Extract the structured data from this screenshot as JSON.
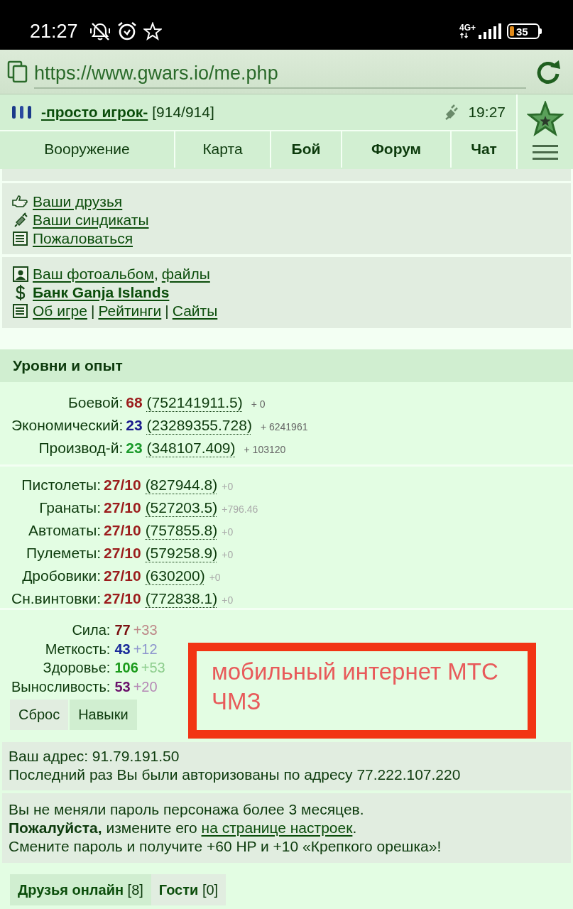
{
  "status_bar": {
    "time": "21:27",
    "network": "4G+",
    "battery": "35"
  },
  "address_bar": {
    "url": "https://www.gwars.io/me.php"
  },
  "header": {
    "player": "-просто игрок-",
    "health": "[914/914]",
    "server_time": "19:27",
    "tabs": [
      {
        "label": "Вооружение",
        "bold": false
      },
      {
        "label": "Карта",
        "bold": false
      },
      {
        "label": "Бой",
        "bold": true
      },
      {
        "label": "Форум",
        "bold": true
      },
      {
        "label": "Чат",
        "bold": true
      }
    ]
  },
  "menu_panels": [
    {
      "items": [
        {
          "bold": false,
          "parts": [
            {
              "kind": "link",
              "text": "Ваши друзья"
            }
          ]
        },
        {
          "bold": false,
          "parts": [
            {
              "kind": "link",
              "text": "Ваши синдикаты"
            }
          ]
        },
        {
          "bold": false,
          "parts": [
            {
              "kind": "link",
              "text": "Пожаловаться"
            }
          ]
        }
      ]
    },
    {
      "items": [
        {
          "bold": false,
          "parts": [
            {
              "kind": "link",
              "text": "Ваш фотоальбом"
            },
            {
              "kind": "text",
              "text": ","
            },
            {
              "kind": "link",
              "text": "файлы"
            }
          ]
        },
        {
          "bold": true,
          "parts": [
            {
              "kind": "link",
              "text": "Банк Ganja Islands"
            }
          ]
        },
        {
          "bold": false,
          "parts": [
            {
              "kind": "link",
              "text": "Об игре"
            },
            {
              "kind": "text",
              "text": "|"
            },
            {
              "kind": "link",
              "text": "Рейтинги"
            },
            {
              "kind": "text",
              "text": "|"
            },
            {
              "kind": "link",
              "text": "Сайты"
            }
          ]
        }
      ]
    }
  ],
  "levels_section": {
    "title": "Уровни и опыт",
    "levels": [
      {
        "label": "Боевой:",
        "value": "68",
        "color": "#9b1c1c",
        "experience": "(752141911.5)",
        "gain": "+ 0"
      },
      {
        "label": "Экономический:",
        "value": "23",
        "color": "#1a1a8c",
        "experience": "(23289355.728)",
        "gain": "+ 6241961"
      },
      {
        "label": "Производ-й:",
        "value": "23",
        "color": "#1a9a2a",
        "experience": "(348107.409)",
        "gain": "+ 103120"
      }
    ],
    "skills": [
      {
        "label": "Пистолеты:",
        "value": "27/10",
        "experience": "(827944.8)",
        "gain": "+0"
      },
      {
        "label": "Гранаты:",
        "value": "27/10",
        "experience": "(527203.5)",
        "gain": "+796.46"
      },
      {
        "label": "Автоматы:",
        "value": "27/10",
        "experience": "(757855.8)",
        "gain": "+0"
      },
      {
        "label": "Пулеметы:",
        "value": "27/10",
        "experience": "(579258.9)",
        "gain": "+0"
      },
      {
        "label": "Дробовики:",
        "value": "27/10",
        "experience": "(630200)",
        "gain": "+0"
      },
      {
        "label": "Сн.винтовки:",
        "value": "27/10",
        "experience": "(772838.1)",
        "gain": "+0"
      }
    ],
    "stats": [
      {
        "label": "Сила:",
        "value": "77",
        "bonus": "+33",
        "color": "#7a1010"
      },
      {
        "label": "Меткость:",
        "value": "43",
        "bonus": "+12",
        "color": "#1a2a9a"
      },
      {
        "label": "Здоровье:",
        "value": "106",
        "bonus": "+53",
        "color": "#1a9a1a"
      },
      {
        "label": "Выносливость:",
        "value": "53",
        "bonus": "+20",
        "color": "#6a106a"
      }
    ],
    "buttons": [
      "Сброс",
      "Навыки"
    ]
  },
  "annotation": {
    "text": "мобильный интернет МТС ЧМЗ"
  },
  "address_info": {
    "lines": [
      "Ваш адрес: 91.79.191.50",
      "Последний раз Вы были авторизованы по адресу 77.222.107.220"
    ]
  },
  "password_notice": {
    "lines": [
      [
        {
          "kind": "text",
          "text": "Вы не меняли пароль персонажа более 3 месяцев."
        }
      ],
      [
        {
          "kind": "text",
          "text": "**Пожалуйста,** измените его "
        },
        {
          "kind": "link",
          "text": "на странице настроек"
        },
        {
          "kind": "text",
          "text": "."
        }
      ],
      [
        {
          "kind": "text",
          "text": "Смените пароль и получите +60 HP и +10 «Крепкого орешка»!"
        }
      ]
    ]
  },
  "friends_tabs": [
    {
      "label": "Друзья онлайн",
      "count": "[8]",
      "selected": true
    },
    {
      "label": "Гости",
      "count": "[0]",
      "selected": false
    }
  ]
}
